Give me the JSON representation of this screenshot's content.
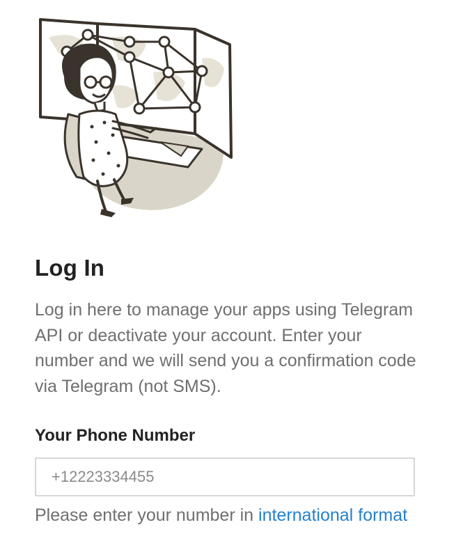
{
  "illustration": {
    "icon": "telegram-login-illustration"
  },
  "login": {
    "title": "Log In",
    "description": "Log in here to manage your apps using Telegram API or deactivate your account. Enter your number and we will send you a confirmation code via Telegram (not SMS).",
    "phone_label": "Your Phone Number",
    "phone_placeholder": "+12223334455",
    "phone_value": "",
    "hint_text": "Please enter your number in ",
    "hint_link": "international format"
  },
  "colors": {
    "link": "#2481cc",
    "muted_text": "#6f6f6f",
    "input_border": "#d6d6d6"
  }
}
